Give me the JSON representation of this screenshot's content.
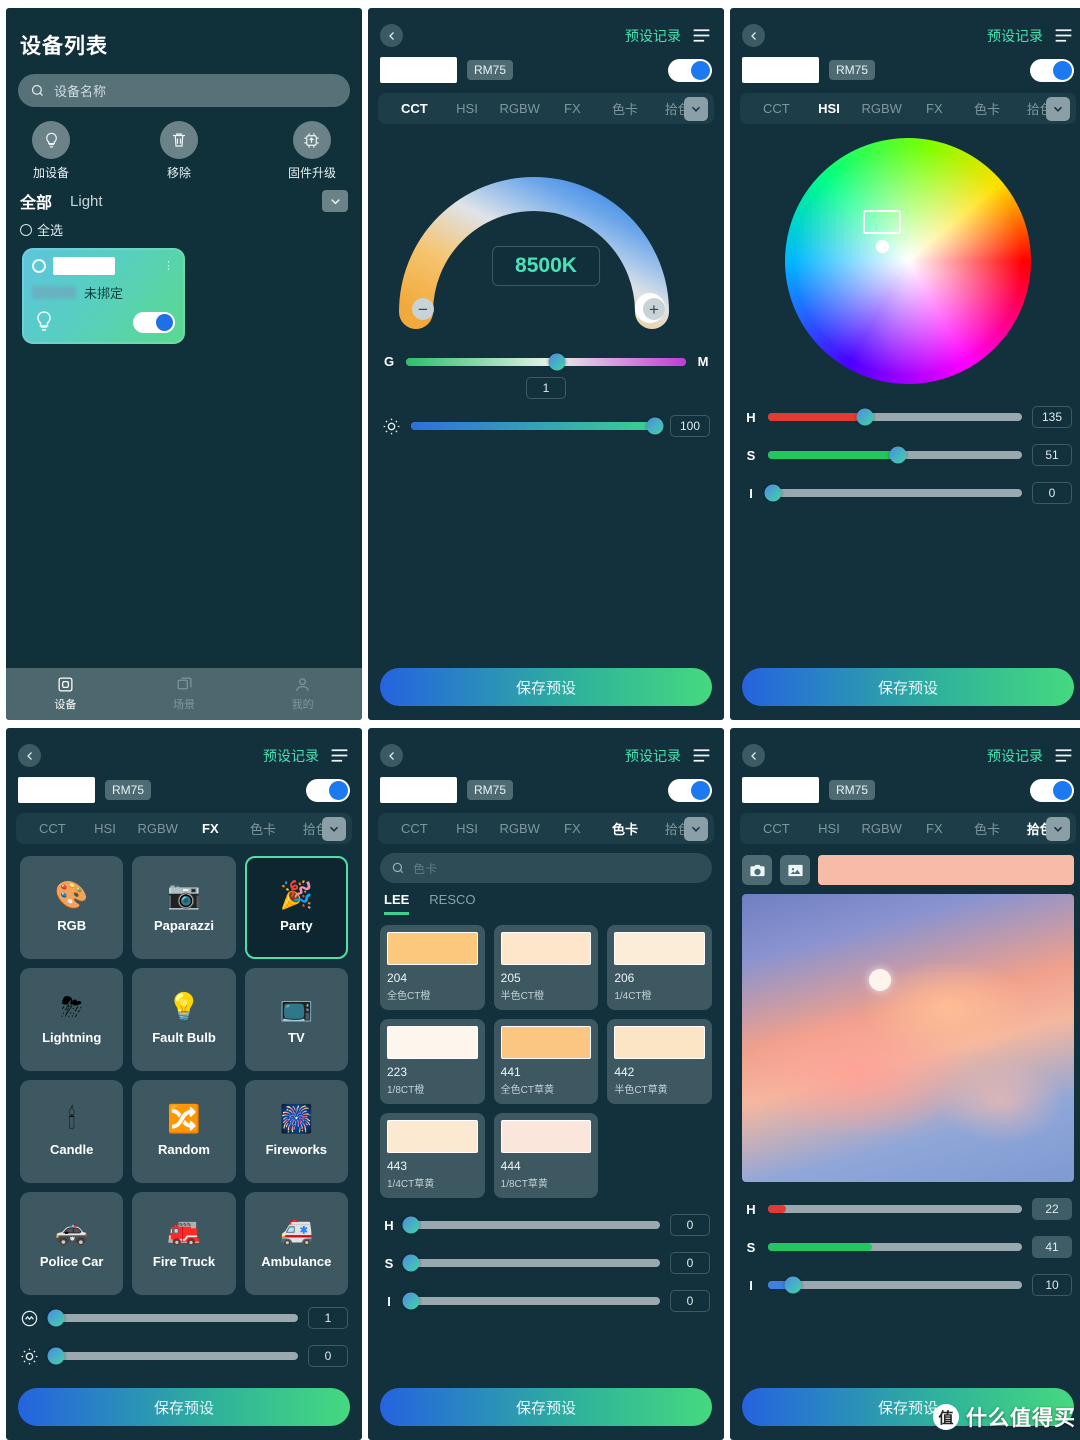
{
  "panel1": {
    "title": "设备列表",
    "search_placeholder": "设备名称",
    "actions": [
      {
        "label": "加设备",
        "icon": "bulb-plus-icon"
      },
      {
        "label": "移除",
        "icon": "trash-icon"
      },
      {
        "label": "固件升级",
        "icon": "chip-upgrade-icon"
      }
    ],
    "filters": {
      "all": "全部",
      "light": "Light"
    },
    "select_all": "全选",
    "device_card": {
      "status": "未挷定",
      "name_value": "",
      "toggle_on": true
    },
    "bottom_nav": [
      {
        "label": "设备",
        "icon": "device-icon",
        "active": true
      },
      {
        "label": "场景",
        "icon": "scene-icon",
        "active": false
      },
      {
        "label": "我的",
        "icon": "profile-icon",
        "active": false
      }
    ]
  },
  "common": {
    "preset_log": "预设记录",
    "model": "RM75",
    "save_preset": "保存预设",
    "tabs": [
      "CCT",
      "HSI",
      "RGBW",
      "FX",
      "色卡",
      "拾色"
    ]
  },
  "panel2": {
    "active_tab": "CCT",
    "cct_value": "8500K",
    "gm": {
      "left": "G",
      "right": "M",
      "value": "1",
      "percent": 54
    },
    "brightness": {
      "value": "100",
      "percent": 98
    }
  },
  "panel3": {
    "active_tab": "HSI",
    "sliders": [
      {
        "label": "H",
        "value": "135",
        "percent": 38,
        "fill": "#e23b33"
      },
      {
        "label": "S",
        "value": "51",
        "percent": 51,
        "fill": "#22c55e"
      },
      {
        "label": "I",
        "value": "0",
        "percent": 0,
        "fill": "#9aa9ad"
      }
    ]
  },
  "panel4": {
    "active_tab": "FX",
    "effects": [
      {
        "label": "RGB",
        "icon": "rgb-circles-icon",
        "glyph": "🎨",
        "selected": false
      },
      {
        "label": "Paparazzi",
        "icon": "camera-flash-icon",
        "glyph": "📸",
        "selected": false
      },
      {
        "label": "Party",
        "icon": "party-popper-icon",
        "glyph": "🎉",
        "selected": true
      },
      {
        "label": "Lightning",
        "icon": "storm-cloud-icon",
        "glyph": "⛈",
        "selected": false
      },
      {
        "label": "Fault Bulb",
        "icon": "broken-bulb-icon",
        "glyph": "💡",
        "selected": false
      },
      {
        "label": "TV",
        "icon": "television-icon",
        "glyph": "📺",
        "selected": false
      },
      {
        "label": "Candle",
        "icon": "candle-icon",
        "glyph": "🕯",
        "selected": false
      },
      {
        "label": "Random",
        "icon": "shuffle-icon",
        "glyph": "🔀",
        "selected": false
      },
      {
        "label": "Fireworks",
        "icon": "fireworks-icon",
        "glyph": "🎆",
        "selected": false
      },
      {
        "label": "Police Car",
        "icon": "police-car-icon",
        "glyph": "🚓",
        "selected": false
      },
      {
        "label": "Fire Truck",
        "icon": "fire-truck-icon",
        "glyph": "🚒",
        "selected": false
      },
      {
        "label": "Ambulance",
        "icon": "ambulance-icon",
        "glyph": "🚑",
        "selected": false
      }
    ],
    "speed": {
      "value": "1",
      "percent": 3,
      "icon": "speed-icon"
    },
    "brightness": {
      "value": "0",
      "percent": 3,
      "icon": "brightness-icon"
    }
  },
  "panel5": {
    "active_tab": "色卡",
    "search_placeholder": "色卡",
    "brand_tabs": [
      {
        "label": "LEE",
        "active": true
      },
      {
        "label": "RESCO",
        "active": false
      }
    ],
    "cards": [
      {
        "no": "204",
        "name": "全色CT橙",
        "color": "#fbc97e"
      },
      {
        "no": "205",
        "name": "半色CT橙",
        "color": "#fde6ca"
      },
      {
        "no": "206",
        "name": "1/4CT橙",
        "color": "#fbedd8"
      },
      {
        "no": "223",
        "name": "1/8CT橙",
        "color": "#fdf6ec"
      },
      {
        "no": "441",
        "name": "全色CT草黄",
        "color": "#fac681"
      },
      {
        "no": "442",
        "name": "半色CT草黄",
        "color": "#fbe5c5"
      },
      {
        "no": "443",
        "name": "1/4CT草黄",
        "color": "#fbe9d2"
      },
      {
        "no": "444",
        "name": "1/8CT草黄",
        "color": "#fbe6dc"
      }
    ],
    "sliders": [
      {
        "label": "H",
        "value": "0",
        "percent": 0
      },
      {
        "label": "S",
        "value": "0",
        "percent": 0
      },
      {
        "label": "I",
        "value": "0",
        "percent": 0
      }
    ]
  },
  "panel6": {
    "active_tab": "拾色",
    "camera_icon": "camera-icon",
    "gallery_icon": "gallery-icon",
    "picked_color": "#f7bca8",
    "sliders": [
      {
        "label": "H",
        "value": "22",
        "percent": 7,
        "fill": "#e23b33"
      },
      {
        "label": "S",
        "value": "41",
        "percent": 41,
        "fill": "#22c55e"
      },
      {
        "label": "I",
        "value": "10",
        "percent": 10,
        "fill": "#3f7fe0"
      }
    ]
  },
  "watermark": {
    "logo": "值",
    "text": "什么值得买"
  }
}
